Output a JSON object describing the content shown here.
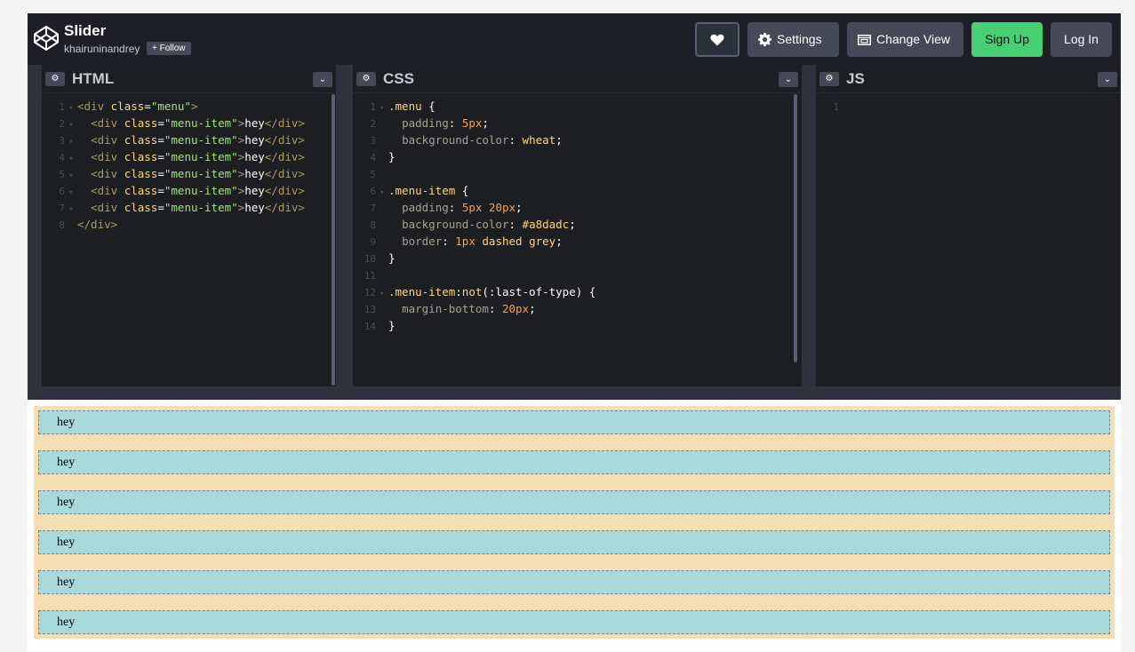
{
  "header": {
    "title": "Slider",
    "author": "khairuninandrey",
    "follow_label": "+ Follow",
    "settings_label": "Settings",
    "change_view_label": "Change View",
    "signup_label": "Sign Up",
    "login_label": "Log In"
  },
  "editors": {
    "html_title": "HTML",
    "css_title": "CSS",
    "js_title": "JS",
    "js_line": "1"
  },
  "html_code": [
    {
      "n": "1",
      "fold": true,
      "indent": "",
      "tag_open": "<div ",
      "attr": "class",
      "eq": "=",
      "str": "\"menu\"",
      "close": ">",
      "text": "",
      "end": ""
    },
    {
      "n": "2",
      "fold": true,
      "indent": "  ",
      "tag_open": "<div ",
      "attr": "class",
      "eq": "=",
      "str": "\"menu-item\"",
      "close": ">",
      "text": "hey",
      "end": "</div>"
    },
    {
      "n": "3",
      "fold": true,
      "indent": "  ",
      "tag_open": "<div ",
      "attr": "class",
      "eq": "=",
      "str": "\"menu-item\"",
      "close": ">",
      "text": "hey",
      "end": "</div>"
    },
    {
      "n": "4",
      "fold": true,
      "indent": "  ",
      "tag_open": "<div ",
      "attr": "class",
      "eq": "=",
      "str": "\"menu-item\"",
      "close": ">",
      "text": "hey",
      "end": "</div>"
    },
    {
      "n": "5",
      "fold": true,
      "indent": "  ",
      "tag_open": "<div ",
      "attr": "class",
      "eq": "=",
      "str": "\"menu-item\"",
      "close": ">",
      "text": "hey",
      "end": "</div>"
    },
    {
      "n": "6",
      "fold": true,
      "indent": "  ",
      "tag_open": "<div ",
      "attr": "class",
      "eq": "=",
      "str": "\"menu-item\"",
      "close": ">",
      "text": "hey",
      "end": "</div>"
    },
    {
      "n": "7",
      "fold": true,
      "indent": "  ",
      "tag_open": "<div ",
      "attr": "class",
      "eq": "=",
      "str": "\"menu-item\"",
      "close": ">",
      "text": "hey",
      "end": "</div>"
    },
    {
      "n": "8",
      "fold": false,
      "indent": "",
      "tag_open": "</div>",
      "attr": "",
      "eq": "",
      "str": "",
      "close": "",
      "text": "",
      "end": ""
    }
  ],
  "css_code": [
    {
      "n": "1",
      "fold": true,
      "parts": [
        [
          "sel",
          ".menu "
        ],
        [
          "punc",
          "{"
        ]
      ]
    },
    {
      "n": "2",
      "fold": false,
      "parts": [
        [
          "punc",
          "  "
        ],
        [
          "prop",
          "padding"
        ],
        [
          "punc",
          ": "
        ],
        [
          "num",
          "5px"
        ],
        [
          "punc",
          ";"
        ]
      ]
    },
    {
      "n": "3",
      "fold": false,
      "parts": [
        [
          "punc",
          "  "
        ],
        [
          "prop",
          "background-color"
        ],
        [
          "punc",
          ": "
        ],
        [
          "val",
          "wheat"
        ],
        [
          "punc",
          ";"
        ]
      ]
    },
    {
      "n": "4",
      "fold": false,
      "parts": [
        [
          "punc",
          "}"
        ]
      ]
    },
    {
      "n": "5",
      "fold": false,
      "parts": []
    },
    {
      "n": "6",
      "fold": true,
      "parts": [
        [
          "sel",
          ".menu-item "
        ],
        [
          "punc",
          "{"
        ]
      ]
    },
    {
      "n": "7",
      "fold": false,
      "parts": [
        [
          "punc",
          "  "
        ],
        [
          "prop",
          "padding"
        ],
        [
          "punc",
          ": "
        ],
        [
          "num",
          "5px 20px"
        ],
        [
          "punc",
          ";"
        ]
      ]
    },
    {
      "n": "8",
      "fold": false,
      "parts": [
        [
          "punc",
          "  "
        ],
        [
          "prop",
          "background-color"
        ],
        [
          "punc",
          ": "
        ],
        [
          "val",
          "#a8dadc"
        ],
        [
          "punc",
          ";"
        ]
      ]
    },
    {
      "n": "9",
      "fold": false,
      "parts": [
        [
          "punc",
          "  "
        ],
        [
          "prop",
          "border"
        ],
        [
          "punc",
          ": "
        ],
        [
          "num",
          "1px "
        ],
        [
          "val",
          "dashed grey"
        ],
        [
          "punc",
          ";"
        ]
      ]
    },
    {
      "n": "10",
      "fold": false,
      "parts": [
        [
          "punc",
          "}"
        ]
      ]
    },
    {
      "n": "11",
      "fold": false,
      "parts": []
    },
    {
      "n": "12",
      "fold": true,
      "parts": [
        [
          "sel",
          ".menu-item"
        ],
        [
          "punc",
          ":"
        ],
        [
          "val",
          "not"
        ],
        [
          "punc",
          "(:last-of-type) {"
        ]
      ]
    },
    {
      "n": "13",
      "fold": false,
      "parts": [
        [
          "punc",
          "  "
        ],
        [
          "prop",
          "margin-bottom"
        ],
        [
          "punc",
          ": "
        ],
        [
          "num",
          "20px"
        ],
        [
          "punc",
          ";"
        ]
      ]
    },
    {
      "n": "14",
      "fold": false,
      "parts": [
        [
          "punc",
          "}"
        ]
      ]
    }
  ],
  "preview": {
    "items": [
      "hey",
      "hey",
      "hey",
      "hey",
      "hey",
      "hey"
    ]
  },
  "colors": {
    "menu_bg": "#f5deb3",
    "item_bg": "#a8dadc",
    "signup_green": "#47cf73"
  },
  "icons": [
    "codepen-logo-icon",
    "heart-icon",
    "gear-icon",
    "change-view-icon",
    "chevron-down-icon"
  ]
}
